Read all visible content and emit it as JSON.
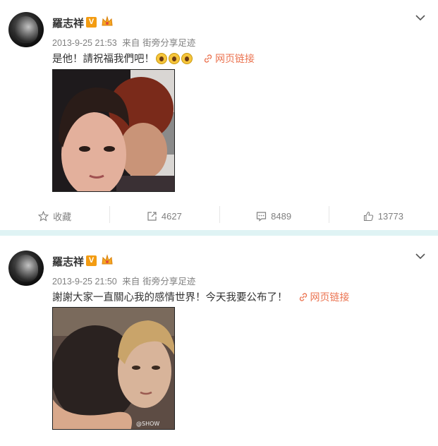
{
  "posts": [
    {
      "username": "羅志祥",
      "vip_badge": "V",
      "time": "2013-9-25 21:53",
      "source_prefix": "来自",
      "source": "街旁分享足迹",
      "text": "是他！請祝福我們吧！",
      "emoji_count": 3,
      "link_label": "网页链接",
      "actions": {
        "favorite": "收藏",
        "repost": "4627",
        "comment": "8489",
        "like": "13773"
      }
    },
    {
      "username": "羅志祥",
      "vip_badge": "V",
      "time": "2013-9-25 21:50",
      "source_prefix": "来自",
      "source": "街旁分享足迹",
      "text": "謝謝大家一直關心我的感情世界！今天我要公布了！",
      "link_label": "网页链接",
      "watermark": "@SHOW"
    }
  ],
  "colors": {
    "link": "#eb7350",
    "divider": "#dff3f4",
    "badge": "#f39c12"
  },
  "icons": [
    "chevron-down-icon",
    "link-icon",
    "star-icon",
    "repost-icon",
    "comment-icon",
    "like-icon"
  ]
}
